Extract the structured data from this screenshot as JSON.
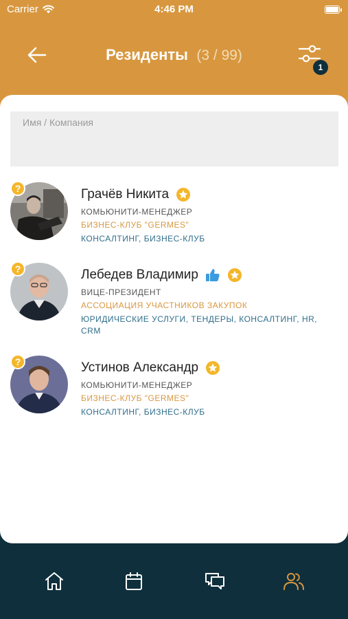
{
  "status": {
    "carrier": "Carrier",
    "time": "4:46 PM"
  },
  "header": {
    "title": "Резиденты",
    "count": "(3 / 99)",
    "filter_badge": "1"
  },
  "search": {
    "placeholder": "Имя / Компания",
    "value": ""
  },
  "residents": [
    {
      "name": "Грачёв Никита",
      "role": "КОМЬЮНИТИ-МЕНЕДЖЕР",
      "company": "БИЗНЕС-КЛУБ \"GERMES\"",
      "tags": "КОНСАЛТИНГ, БИЗНЕС-КЛУБ",
      "badges": [
        "star-icon"
      ]
    },
    {
      "name": "Лебедев Владимир",
      "role": "ВИЦЕ-ПРЕЗИДЕНТ",
      "company": "АССОЦИАЦИЯ УЧАСТНИКОВ ЗАКУПОК",
      "tags": "ЮРИДИЧЕСКИЕ УСЛУГИ, ТЕНДЕРЫ, КОНСАЛТИНГ, HR, CRM",
      "badges": [
        "thumbs-up-icon",
        "star-icon"
      ]
    },
    {
      "name": "Устинов Александр",
      "role": "КОМЬЮНИТИ-МЕНЕДЖЕР",
      "company": "БИЗНЕС-КЛУБ \"GERMES\"",
      "tags": "КОНСАЛТИНГ, БИЗНЕС-КЛУБ",
      "badges": [
        "star-icon"
      ]
    }
  ],
  "question_badge": "?",
  "tabs": [
    "home-icon",
    "calendar-icon",
    "chat-icon",
    "people-icon"
  ],
  "colors": {
    "header": "#d8973f",
    "accent": "#d8973f",
    "tag": "#2f6e8c",
    "tabbar": "#0f2f3c",
    "star": "#f4b62a",
    "thumb": "#3a9be0"
  }
}
